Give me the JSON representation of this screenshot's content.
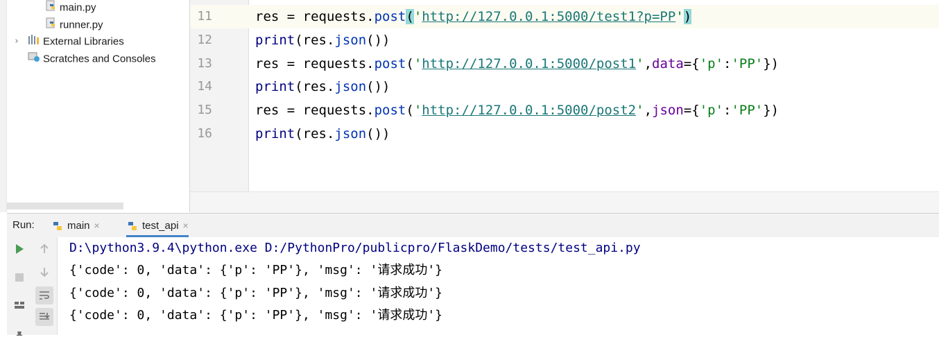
{
  "project_tree": {
    "items": [
      {
        "label": "main.py",
        "icon": "python-file-icon"
      },
      {
        "label": "runner.py",
        "icon": "python-file-icon"
      },
      {
        "label": "External Libraries",
        "icon": "library-icon"
      },
      {
        "label": "Scratches and Consoles",
        "icon": "scratches-icon"
      }
    ]
  },
  "editor": {
    "lines": [
      {
        "number": "11",
        "tokens": [
          "res = requests.",
          "post",
          "(",
          "'",
          "http://127.0.0.1:5000/test1?p=PP",
          "'",
          ")"
        ]
      },
      {
        "number": "12",
        "tokens": [
          "print",
          "(res.",
          "json",
          "())"
        ]
      },
      {
        "number": "13",
        "tokens": [
          "res = requests.",
          "post",
          "(",
          "'",
          "http://127.0.0.1:5000/post1",
          "'",
          ",",
          "data",
          "={",
          "'p'",
          ":",
          "'PP'",
          "})"
        ]
      },
      {
        "number": "14",
        "tokens": [
          "print",
          "(res.",
          "json",
          "())"
        ]
      },
      {
        "number": "15",
        "tokens": [
          "res = requests.",
          "post",
          "(",
          "'",
          "http://127.0.0.1:5000/post2",
          "'",
          ",",
          "json",
          "={",
          "'p'",
          ":",
          "'PP'",
          "})"
        ]
      },
      {
        "number": "16",
        "tokens": [
          "print",
          "(res.",
          "json",
          "())"
        ]
      }
    ]
  },
  "run_panel": {
    "label": "Run:",
    "tabs": [
      {
        "label": "main",
        "close": "×"
      },
      {
        "label": "test_api",
        "close": "×"
      }
    ],
    "console": [
      "D:\\python3.9.4\\python.exe D:/PythonPro/publicpro/FlaskDemo/tests/test_api.py",
      "{'code': 0, 'data': {'p': 'PP'}, 'msg': '请求成功'}",
      "{'code': 0, 'data': {'p': 'PP'}, 'msg': '请求成功'}",
      "{'code': 0, 'data': {'p': 'PP'}, 'msg': '请求成功'}"
    ]
  },
  "colors": {
    "keyword": "#000080",
    "string": "#067d17",
    "kwarg": "#660099",
    "run_green": "#499c54",
    "current_line": "#fbfbf1"
  }
}
